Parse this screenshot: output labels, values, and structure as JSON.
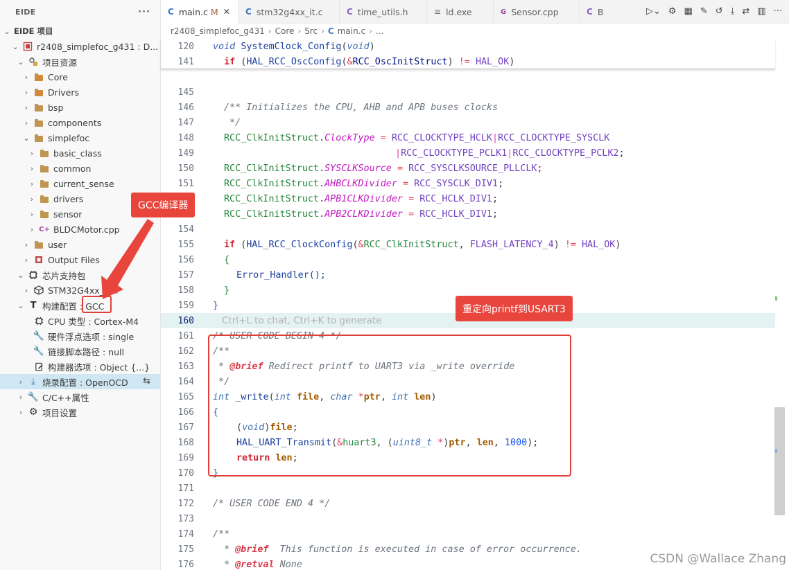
{
  "sidebar": {
    "title": "EIDE",
    "more": "···",
    "section": "EIDE 项目",
    "project": "r2408_simplefoc_g431 : D...",
    "items": [
      {
        "label": "项目资源"
      },
      {
        "label": "Core"
      },
      {
        "label": "Drivers"
      },
      {
        "label": "bsp"
      },
      {
        "label": "components"
      },
      {
        "label": "simplefoc"
      },
      {
        "label": "basic_class"
      },
      {
        "label": "common"
      },
      {
        "label": "current_sense"
      },
      {
        "label": "drivers"
      },
      {
        "label": "sensor"
      },
      {
        "label": "BLDCMotor.cpp"
      },
      {
        "label": "user"
      },
      {
        "label": "Output Files"
      },
      {
        "label": "芯片支持包"
      },
      {
        "label": "STM32G4xx_DFP"
      },
      {
        "label": "构建配置 : GCC"
      },
      {
        "label": "CPU 类型 : Cortex-M4"
      },
      {
        "label": "硬件浮点选项 : single"
      },
      {
        "label": "链接脚本路径 : null"
      },
      {
        "label": "构建器选项 : Object {...}"
      },
      {
        "label": "烧录配置 : OpenOCD"
      },
      {
        "label": "C/C++属性"
      },
      {
        "label": "项目设置"
      }
    ]
  },
  "tabs": [
    {
      "label": "main.c",
      "modified": "M",
      "close": "✕"
    },
    {
      "label": "stm32g4xx_it.c"
    },
    {
      "label": "time_utils.h"
    },
    {
      "label": "ld.exe"
    },
    {
      "label": "Sensor.cpp"
    },
    {
      "label": "B"
    }
  ],
  "breadcrumb": [
    "r2408_simplefoc_g431",
    "Core",
    "Src",
    "main.c",
    "..."
  ],
  "editor": {
    "sticky": [
      {
        "n": "120",
        "text": "void SystemClock_Config(void)"
      },
      {
        "n": "141",
        "text": "if (HAL_RCC_OscConfig(&RCC_OscInitStruct) != HAL_OK)"
      }
    ],
    "lines": [
      {
        "n": "145",
        "text": ""
      },
      {
        "n": "146",
        "text": "/** Initializes the CPU, AHB and APB buses clocks"
      },
      {
        "n": "147",
        "text": "*/"
      },
      {
        "n": "148",
        "text": "RCC_ClkInitStruct.ClockType = RCC_CLOCKTYPE_HCLK|RCC_CLOCKTYPE_SYSCLK"
      },
      {
        "n": "149",
        "text": "|RCC_CLOCKTYPE_PCLK1|RCC_CLOCKTYPE_PCLK2;"
      },
      {
        "n": "150",
        "text": "RCC_ClkInitStruct.SYSCLKSource = RCC_SYSCLKSOURCE_PLLCLK;"
      },
      {
        "n": "151",
        "text": "RCC_ClkInitStruct.AHBCLKDivider = RCC_SYSCLK_DIV1;"
      },
      {
        "n": "152",
        "text": "RCC_ClkInitStruct.APB1CLKDivider = RCC_HCLK_DIV1;"
      },
      {
        "n": "153",
        "text": "RCC_ClkInitStruct.APB2CLKDivider = RCC_HCLK_DIV1;"
      },
      {
        "n": "154",
        "text": ""
      },
      {
        "n": "155",
        "text": "if (HAL_RCC_ClockConfig(&RCC_ClkInitStruct, FLASH_LATENCY_4) != HAL_OK)"
      },
      {
        "n": "156",
        "text": "{"
      },
      {
        "n": "157",
        "text": "Error_Handler();"
      },
      {
        "n": "158",
        "text": "}"
      },
      {
        "n": "159",
        "text": "}"
      },
      {
        "n": "160",
        "text": "Ctrl+L to chat, Ctrl+K to generate"
      },
      {
        "n": "161",
        "text": "/* USER CODE BEGIN 4 */"
      },
      {
        "n": "162",
        "text": "/**"
      },
      {
        "n": "163",
        "text": " * @brief Redirect printf to UART3 via _write override"
      },
      {
        "n": "164",
        "text": " */"
      },
      {
        "n": "165",
        "text": "int _write(int file, char *ptr, int len)"
      },
      {
        "n": "166",
        "text": "{"
      },
      {
        "n": "167",
        "text": "(void)file;"
      },
      {
        "n": "168",
        "text": "HAL_UART_Transmit(&huart3, (uint8_t *)ptr, len, 1000);"
      },
      {
        "n": "169",
        "text": "return len;"
      },
      {
        "n": "170",
        "text": "}"
      },
      {
        "n": "171",
        "text": ""
      },
      {
        "n": "172",
        "text": "/* USER CODE END 4 */"
      },
      {
        "n": "173",
        "text": ""
      },
      {
        "n": "174",
        "text": "/**"
      },
      {
        "n": "175",
        "text": "* @brief  This function is executed in case of error occurrence."
      },
      {
        "n": "176",
        "text": "* @retval None"
      }
    ]
  },
  "callouts": {
    "gcc": "GCC编译器",
    "redirect": "重定向printf到USART3"
  },
  "watermark": "CSDN @Wallace Zhang",
  "colors": {
    "callout": "#e8453c",
    "box": "#e0403a",
    "selection": "#cfe6f3"
  }
}
